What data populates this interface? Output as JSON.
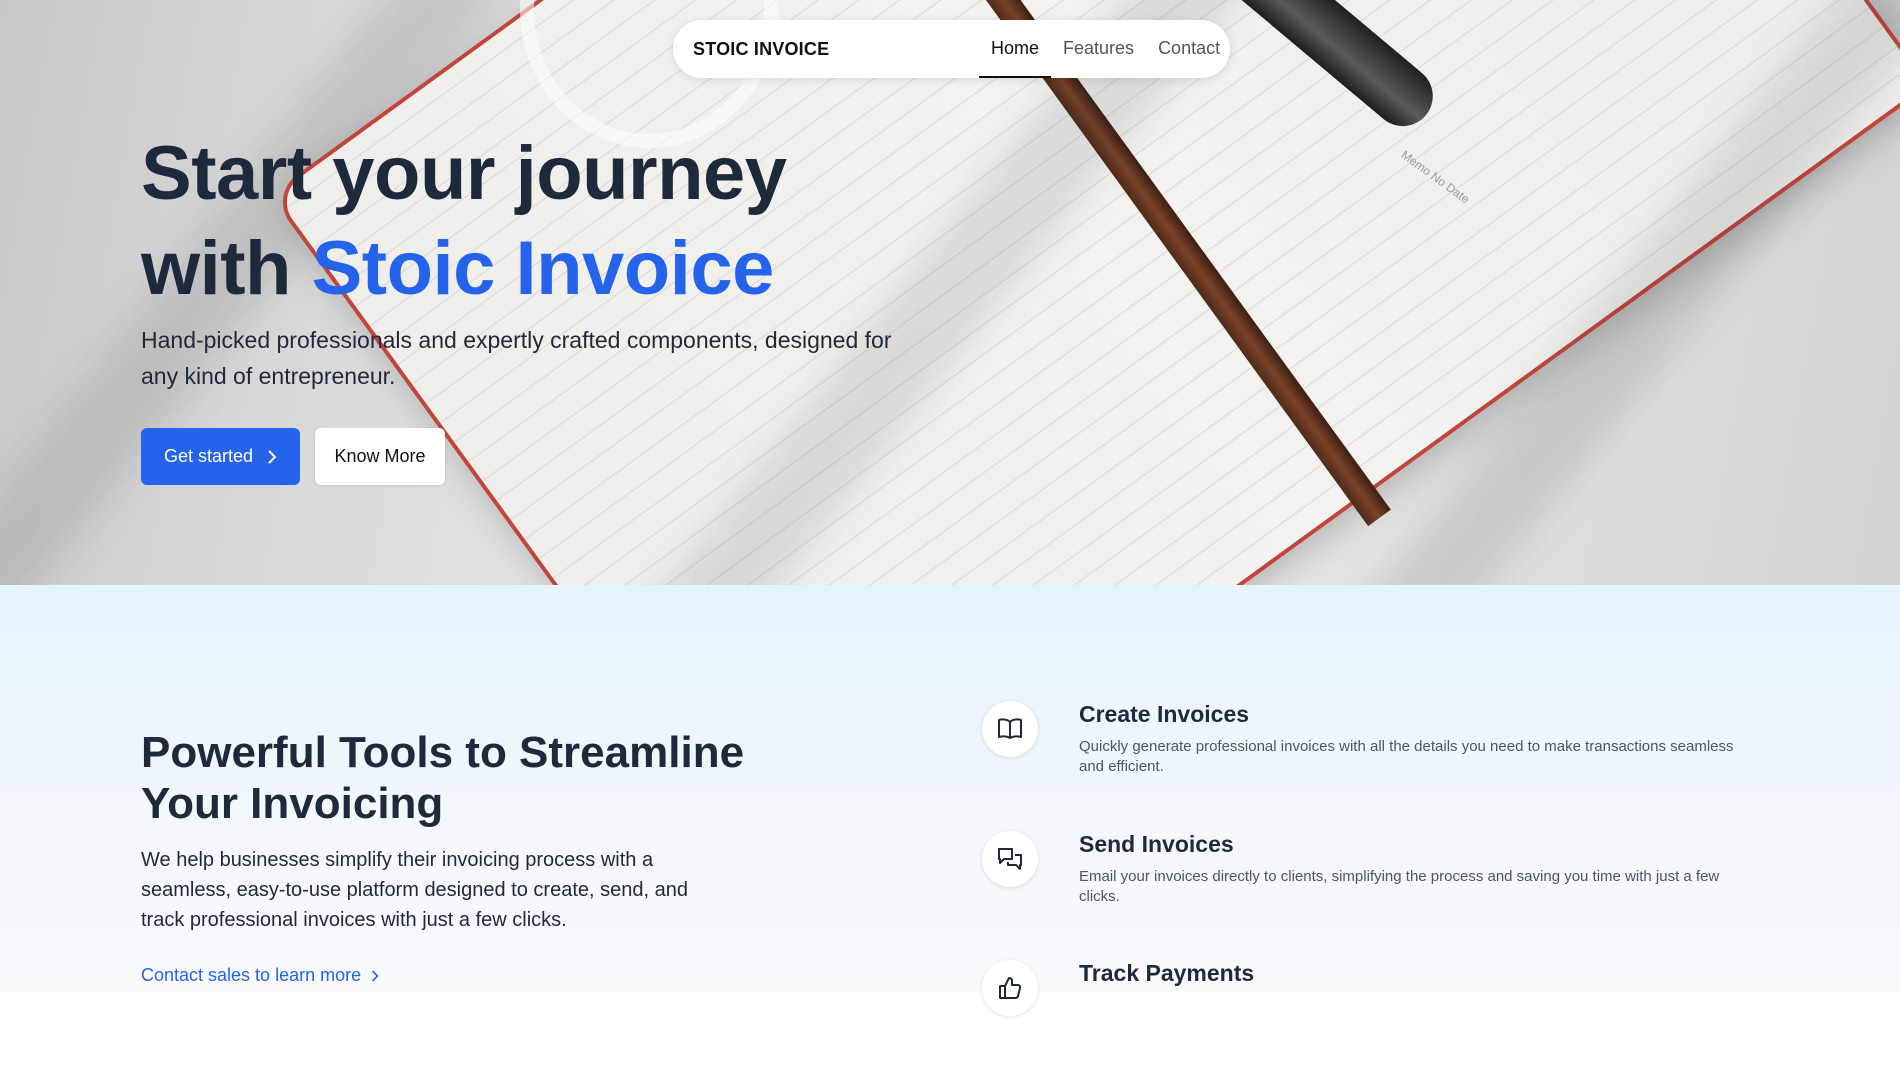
{
  "nav": {
    "brand": "STOIC INVOICE",
    "links": [
      {
        "label": "Home",
        "active": true
      },
      {
        "label": "Features",
        "active": false
      },
      {
        "label": "Contact",
        "active": false
      }
    ]
  },
  "hero": {
    "title_line1": "Start your journey",
    "title_prefix": "with ",
    "title_accent": "Stoic Invoice",
    "subtitle": "Hand-picked professionals and expertly crafted components, designed for any kind of entrepreneur.",
    "primary_button": "Get started",
    "secondary_button": "Know More",
    "memo_text": "Memo No Date"
  },
  "features": {
    "title": "Powerful Tools to Streamline Your Invoicing",
    "description": "We help businesses simplify their invoicing process with a seamless, easy-to-use platform designed to create, send, and track professional invoices with just a few clicks.",
    "contact_link": "Contact sales to learn more",
    "items": [
      {
        "icon": "book-open-icon",
        "title": "Create Invoices",
        "text": "Quickly generate professional invoices with all the details you need to make transactions seamless and efficient."
      },
      {
        "icon": "chat-bubbles-icon",
        "title": "Send Invoices",
        "text": "Email your invoices directly to clients, simplifying the process and saving you time with just a few clicks."
      },
      {
        "icon": "thumbs-up-icon",
        "title": "Track Payments",
        "text": ""
      }
    ]
  },
  "colors": {
    "accent": "#2563eb",
    "heading": "#1e293b",
    "section_bg": "#e6f3fc"
  }
}
